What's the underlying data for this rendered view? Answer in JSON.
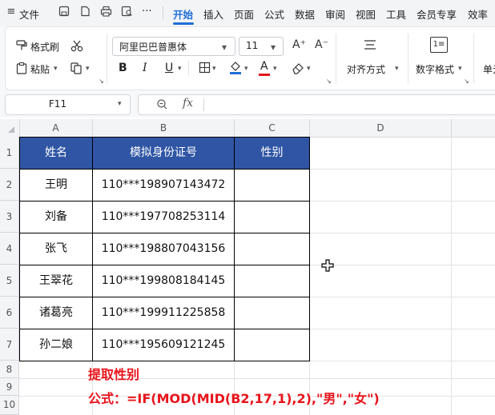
{
  "menubar": {
    "file_label": "文件",
    "tabs": [
      "开始",
      "插入",
      "页面",
      "公式",
      "数据",
      "审阅",
      "视图",
      "工具",
      "会员专享",
      "效率"
    ],
    "more_label": "⋯"
  },
  "ribbon": {
    "format_painter": "格式刷",
    "paste": "粘贴",
    "font_name": "阿里巴巴普惠体",
    "font_size": "11",
    "bold": "B",
    "italic": "I",
    "underline": "U",
    "font_color_letter": "A",
    "grow_font": "A⁺",
    "shrink_font": "A⁻",
    "align_label": "对齐方式",
    "number_label": "数字格式",
    "cell_label": "单元",
    "number_icon": "1≡"
  },
  "formula_bar": {
    "cell_ref": "F11",
    "fx": "fx",
    "formula_value": ""
  },
  "columns": [
    "A",
    "B",
    "C",
    "D"
  ],
  "rows": [
    "1",
    "2",
    "3",
    "4",
    "5",
    "6",
    "7",
    "8",
    "9",
    "10"
  ],
  "table": {
    "headers": [
      "姓名",
      "模拟身份证号",
      "性别"
    ],
    "records": [
      {
        "name": "王明",
        "id": "110***198907143472",
        "gender": ""
      },
      {
        "name": "刘备",
        "id": "110***197708253114",
        "gender": ""
      },
      {
        "name": "张飞",
        "id": "110***198807043156",
        "gender": ""
      },
      {
        "name": "王翠花",
        "id": "110***199808184145",
        "gender": ""
      },
      {
        "name": "诸葛亮",
        "id": "110***199911225858",
        "gender": ""
      },
      {
        "name": "孙二娘",
        "id": "110***195609121245",
        "gender": ""
      }
    ]
  },
  "annotation": {
    "line1": "提取性别",
    "line2": "公式：=IF(MOD(MID(B2,17,1),2),\"男\",\"女\")"
  },
  "colors": {
    "accent": "#1f6fd6",
    "header_fill": "#2f55a4",
    "annotation": "#e8141b"
  }
}
